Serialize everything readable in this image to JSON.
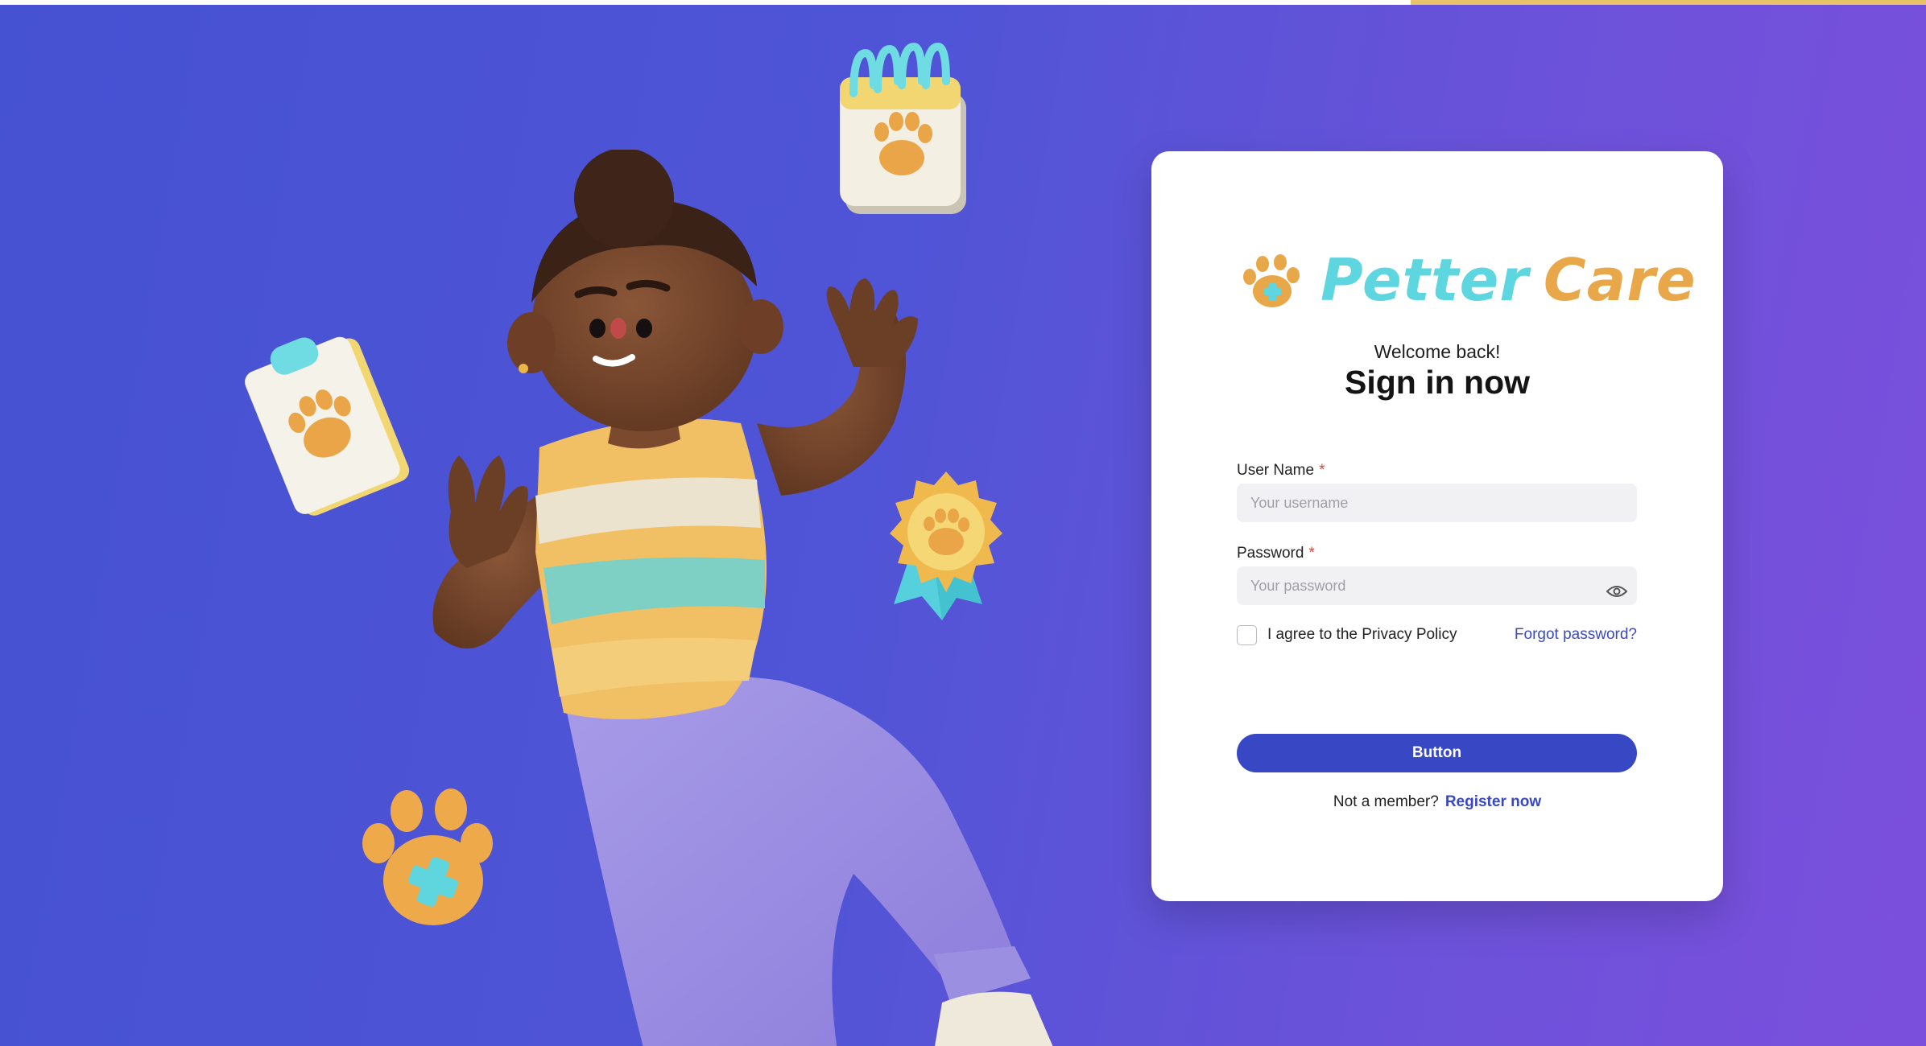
{
  "brand": {
    "name": "Petter Care",
    "name_part1": "Pet",
    "name_part2": "ter",
    "name_part3": "Care"
  },
  "login": {
    "welcome": "Welcome back!",
    "title": "Sign in now",
    "username_label": "User Name",
    "username_placeholder": "Your username",
    "password_label": "Password",
    "password_placeholder": "Your password",
    "required_mark": "*",
    "agree_label": "I agree to the Privacy Policy",
    "forgot_link": "Forgot password?",
    "submit_label": "Button",
    "not_member": "Not a member?",
    "register_link": "Register now"
  },
  "icons": {
    "show_password": "eye-icon",
    "logo": "paw-cross-icon",
    "illustration": [
      "calendar-paw-icon",
      "clipboard-paw-icon",
      "award-badge-paw-icon",
      "paw-cross-icon"
    ]
  },
  "colors": {
    "background_start": "#4552d2",
    "background_end": "#7b4fdc",
    "primary_button": "#3848c5",
    "link": "#3a4bbe",
    "required": "#e0463c",
    "logo_cyan": "#5ed6e0",
    "logo_orange": "#e8a84a"
  }
}
